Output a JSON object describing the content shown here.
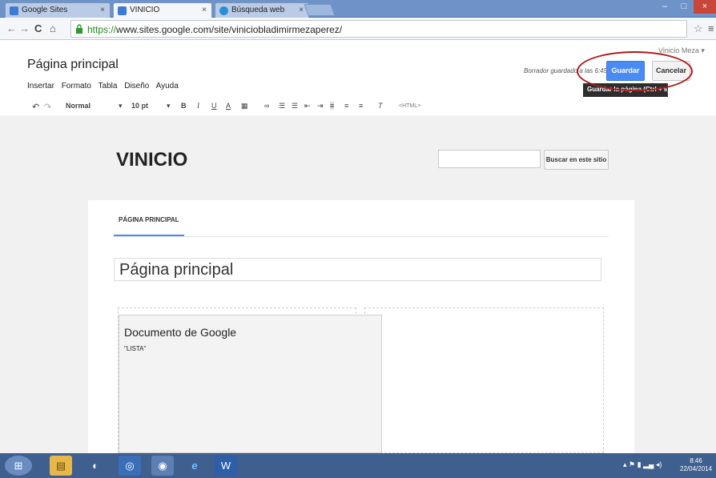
{
  "browser": {
    "tabs": [
      {
        "label": "Google Sites",
        "close": "×"
      },
      {
        "label": "VINICIO",
        "close": "×"
      },
      {
        "label": "Búsqueda web",
        "close": "×"
      }
    ],
    "url_scheme": "https://",
    "url_rest": "www.sites.google.com/site/viniciobladimirmezaperez/",
    "window_min": "–",
    "window_max": "□",
    "window_close": "×"
  },
  "editor": {
    "page_title": "Página principal",
    "menus": [
      "Insertar",
      "Formato",
      "Tabla",
      "Diseño",
      "Ayuda"
    ],
    "user": "Vinicio Meza ▾",
    "draft_status": "Borrador guardado a las 6:45",
    "save_label": "Guardar",
    "cancel_label": "Cancelar",
    "tooltip": "Guardar la página (Ctrl + s)"
  },
  "toolbar": {
    "style": "Normal",
    "font_size": "10 pt",
    "html": "<HTML>"
  },
  "site": {
    "name": "VINICIO",
    "search_button": "Buscar en este sitio",
    "nav_tab": "PÁGINA PRINCIPAL",
    "page_title": "Página principal",
    "gadget_title": "Documento de Google",
    "gadget_subtitle": "\"LISTA\""
  },
  "taskbar": {
    "time": "8:46",
    "date": "22/04/2014"
  },
  "colors": {
    "accent": "#4a8af4",
    "taskbar": "#3f5f8f",
    "highlight_oval": "#b01818"
  }
}
